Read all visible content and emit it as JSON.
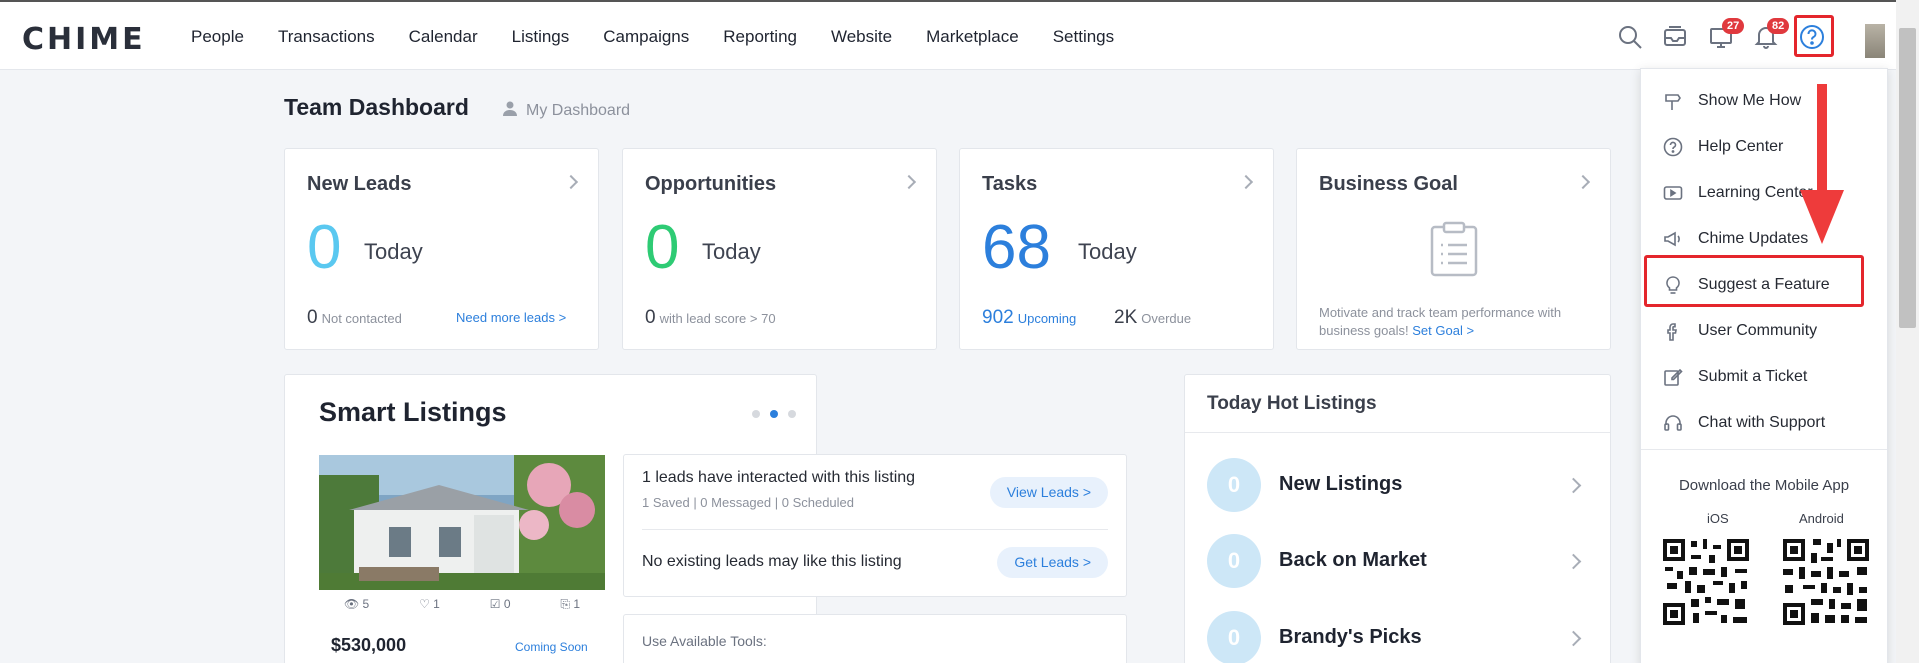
{
  "app": {
    "logo_text": "CHIME",
    "nav": [
      "People",
      "Transactions",
      "Calendar",
      "Listings",
      "Campaigns",
      "Reporting",
      "Website",
      "Marketplace",
      "Settings"
    ],
    "badges": {
      "tasks": "27",
      "notifications": "82"
    }
  },
  "dashboard": {
    "title": "Team Dashboard",
    "my_dashboard": "My Dashboard"
  },
  "cards": {
    "new_leads": {
      "title": "New Leads",
      "value": "0",
      "today": "Today",
      "sub_num": "0",
      "sub_text": "Not contacted",
      "link": "Need more leads >"
    },
    "opportunities": {
      "title": "Opportunities",
      "value": "0",
      "today": "Today",
      "sub_num": "0",
      "sub_text": "with lead score > 70"
    },
    "tasks": {
      "title": "Tasks",
      "value": "68",
      "today": "Today",
      "upcoming_num": "902",
      "upcoming_label": "Upcoming",
      "overdue_num": "2K",
      "overdue_label": "Overdue"
    },
    "business_goal": {
      "title": "Business Goal",
      "desc": "Motivate and track team performance with business goals!",
      "link": "Set Goal >"
    }
  },
  "smart_listings": {
    "title": "Smart Listings",
    "stats": {
      "views": "5",
      "likes": "1",
      "saves": "0",
      "shares": "1"
    },
    "price": "$530,000",
    "status": "Coming Soon",
    "lead_interaction": "1 leads have interacted with this listing",
    "lead_interaction_sub": "1 Saved | 0 Messaged | 0 Scheduled",
    "view_leads": "View Leads >",
    "no_leads": "No existing leads may like this listing",
    "get_leads": "Get Leads >",
    "tools": "Use Available Tools:"
  },
  "hot_listings": {
    "title": "Today Hot Listings",
    "rows": [
      {
        "count": "0",
        "label": "New Listings"
      },
      {
        "count": "0",
        "label": "Back on Market"
      },
      {
        "count": "0",
        "label": "Brandy's Picks"
      }
    ]
  },
  "help_menu": {
    "items": [
      "Show Me How",
      "Help Center",
      "Learning Center",
      "Chime Updates",
      "Suggest a Feature",
      "User Community",
      "Submit a Ticket",
      "Chat with Support"
    ],
    "download_title": "Download the Mobile App",
    "ios": "iOS",
    "android": "Android"
  },
  "colors": {
    "accent_blue": "#2c7fdc",
    "leads_cyan": "#5ac8f0",
    "opportunities_green": "#2ecb74",
    "highlight_red": "#e4262c"
  }
}
